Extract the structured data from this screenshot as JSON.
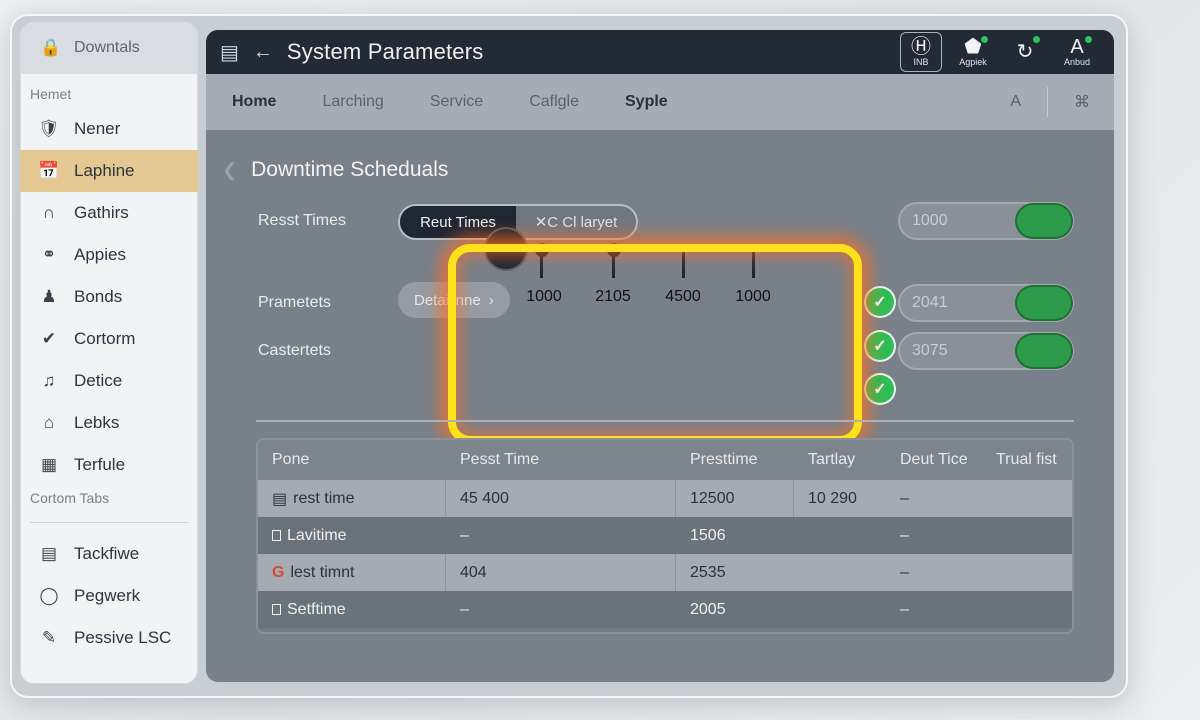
{
  "sidebar": {
    "header": "Downtals",
    "section1": "Hemet",
    "items": [
      {
        "label": "Nener",
        "icon": "shield-icon"
      },
      {
        "label": "Laphine",
        "icon": "calendar-icon",
        "active": true
      },
      {
        "label": "Gathirs",
        "icon": "arch-icon"
      },
      {
        "label": "Appies",
        "icon": "tag-icon"
      },
      {
        "label": "Bonds",
        "icon": "person-icon"
      },
      {
        "label": "Cortorm",
        "icon": "bird-icon"
      },
      {
        "label": "Detice",
        "icon": "music-icon"
      },
      {
        "label": "Lebks",
        "icon": "home-icon"
      },
      {
        "label": "Terfule",
        "icon": "grid-icon"
      }
    ],
    "section2": "Cortom Tabs",
    "items2": [
      {
        "label": "Tackfiwe",
        "icon": "building-icon"
      },
      {
        "label": "Pegwerk",
        "icon": "globe-icon"
      },
      {
        "label": "Pessive LSC",
        "icon": "pen-icon"
      }
    ]
  },
  "window": {
    "title": "System Parameters",
    "toolbar": [
      {
        "glyph": "Ⓗ",
        "label": "INB",
        "icon": "h-icon"
      },
      {
        "glyph": "⬟",
        "label": "Agpiek",
        "icon": "leaf-icon"
      },
      {
        "glyph": "↻",
        "label": "",
        "icon": "refresh-icon"
      },
      {
        "glyph": "A",
        "label": "Anbud",
        "icon": "font-icon"
      }
    ]
  },
  "tabs": [
    "Home",
    "Larching",
    "Service",
    "Caflgle",
    "Syple"
  ],
  "tabs_right": [
    "A",
    "⌘"
  ],
  "section": {
    "title": "Downtime Scheduals",
    "row1_label": "Resst Times",
    "seg_on": "Reut Times",
    "seg_off": "✕C Cl laryet",
    "row2_label": "Prametets",
    "pill": "Detaiilnne",
    "row3_label": "Castertets",
    "toggles": [
      "1000",
      "2041",
      "3075"
    ]
  },
  "timeline": {
    "labels": [
      "1000",
      "2105",
      "4500",
      "1000"
    ]
  },
  "table": {
    "headers": [
      "Pone",
      "Pesst Time",
      "Presttime",
      "Tartlay",
      "Deut Tice",
      "Trual fist"
    ],
    "rows": [
      [
        "rest time",
        "45 400",
        "12500",
        "10 290",
        "–",
        ""
      ],
      [
        "Lavitime",
        "–",
        "1506",
        "",
        "–",
        ""
      ],
      [
        "lest timnt",
        "404",
        "2535",
        "",
        "–",
        ""
      ],
      [
        "Setftime",
        "–",
        "2005",
        "",
        "–",
        ""
      ]
    ]
  }
}
